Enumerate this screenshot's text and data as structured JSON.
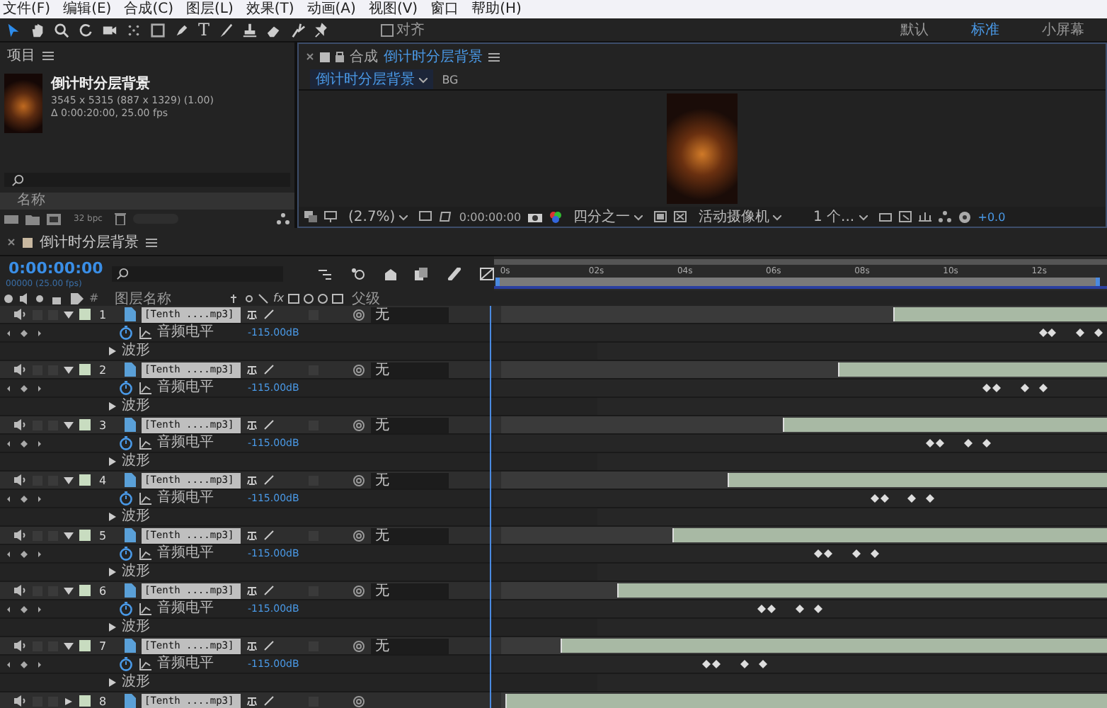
{
  "menu": [
    "文件(F)",
    "编辑(E)",
    "合成(C)",
    "图层(L)",
    "效果(T)",
    "动画(A)",
    "视图(V)",
    "窗口",
    "帮助(H)"
  ],
  "toolbar": {
    "text_tool": "T",
    "snap": {
      "label": "对齐",
      "checked": false
    },
    "workspaces": [
      {
        "label": "默认",
        "selected": false
      },
      {
        "label": "标准",
        "selected": true
      },
      {
        "label": "小屏幕",
        "selected": false
      }
    ]
  },
  "project": {
    "title": "项目",
    "item": {
      "name": "倒计时分层背景",
      "size": "3545 x 5315  (887 x 1329) (1.00)",
      "duration": "Δ 0:00:20:00, 25.00 fps"
    },
    "column": "名称",
    "bpc": "32 bpc"
  },
  "composition": {
    "tab_label": "合成",
    "tab_name": "倒计时分层背景",
    "breadcrumb": "倒计时分层背景",
    "layer": "BG",
    "zoom": "(2.7%)",
    "time": "0:00:00:00",
    "resolution": "四分之一",
    "camera": "活动摄像机",
    "views": "1 个...",
    "exposure": "+0.0"
  },
  "timeline": {
    "tab": "倒计时分层背景",
    "time": "0:00:00:00",
    "frames": "00000 (25.00 fps)",
    "columns": {
      "number": "#",
      "effects": "fx",
      "name": "图层名称",
      "parent": "父级"
    },
    "ticks": [
      "0s",
      "02s",
      "04s",
      "06s",
      "08s",
      "10s",
      "12s"
    ],
    "layers": [
      {
        "number": "1",
        "name": "[Tenth ....mp3]",
        "solo": false,
        "locked": false,
        "effects_on": false,
        "parent": "无",
        "property": "音频电平",
        "value": "-115.00dB",
        "waveform": "波形"
      },
      {
        "number": "2",
        "name": "[Tenth ....mp3]",
        "solo": false,
        "locked": false,
        "effects_on": false,
        "parent": "无",
        "property": "音频电平",
        "value": "-115.00dB",
        "waveform": "波形"
      },
      {
        "number": "3",
        "name": "[Tenth ....mp3]",
        "solo": false,
        "locked": false,
        "effects_on": false,
        "parent": "无",
        "property": "音频电平",
        "value": "-115.00dB",
        "waveform": "波形"
      },
      {
        "number": "4",
        "name": "[Tenth ....mp3]",
        "solo": false,
        "locked": false,
        "effects_on": false,
        "parent": "无",
        "property": "音频电平",
        "value": "-115.00dB",
        "waveform": "波形"
      },
      {
        "number": "5",
        "name": "[Tenth ....mp3]",
        "solo": false,
        "locked": false,
        "effects_on": false,
        "parent": "无",
        "property": "音频电平",
        "value": "-115.00dB",
        "waveform": "波形"
      },
      {
        "number": "6",
        "name": "[Tenth ....mp3]",
        "solo": false,
        "locked": false,
        "effects_on": false,
        "parent": "无",
        "property": "音频电平",
        "value": "-115.00dB",
        "waveform": "波形"
      },
      {
        "number": "7",
        "name": "[Tenth ....mp3]",
        "solo": false,
        "locked": false,
        "effects_on": false,
        "parent": "无",
        "property": "音频电平",
        "value": "-115.00dB",
        "waveform": "波形"
      },
      {
        "number": "8",
        "name": "[Tenth ....mp3]",
        "solo": false,
        "locked": false,
        "effects_on": false
      }
    ]
  }
}
